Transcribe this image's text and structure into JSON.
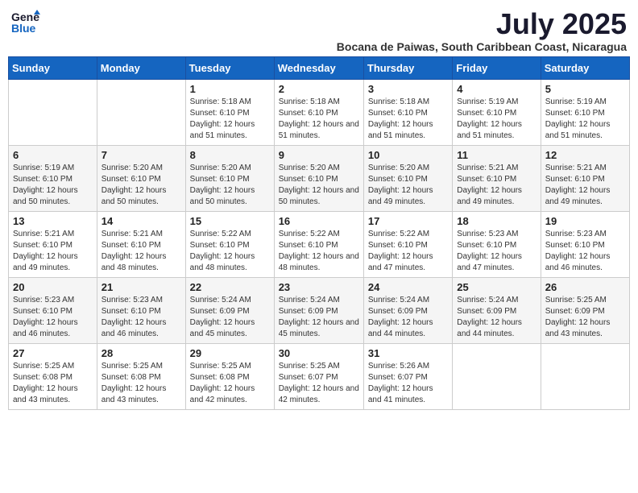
{
  "header": {
    "logo_line1": "General",
    "logo_line2": "Blue",
    "month_year": "July 2025",
    "location": "Bocana de Paiwas, South Caribbean Coast, Nicaragua"
  },
  "weekdays": [
    "Sunday",
    "Monday",
    "Tuesday",
    "Wednesday",
    "Thursday",
    "Friday",
    "Saturday"
  ],
  "weeks": [
    [
      {
        "day": "",
        "sunrise": "",
        "sunset": "",
        "daylight": ""
      },
      {
        "day": "",
        "sunrise": "",
        "sunset": "",
        "daylight": ""
      },
      {
        "day": "1",
        "sunrise": "Sunrise: 5:18 AM",
        "sunset": "Sunset: 6:10 PM",
        "daylight": "Daylight: 12 hours and 51 minutes."
      },
      {
        "day": "2",
        "sunrise": "Sunrise: 5:18 AM",
        "sunset": "Sunset: 6:10 PM",
        "daylight": "Daylight: 12 hours and 51 minutes."
      },
      {
        "day": "3",
        "sunrise": "Sunrise: 5:18 AM",
        "sunset": "Sunset: 6:10 PM",
        "daylight": "Daylight: 12 hours and 51 minutes."
      },
      {
        "day": "4",
        "sunrise": "Sunrise: 5:19 AM",
        "sunset": "Sunset: 6:10 PM",
        "daylight": "Daylight: 12 hours and 51 minutes."
      },
      {
        "day": "5",
        "sunrise": "Sunrise: 5:19 AM",
        "sunset": "Sunset: 6:10 PM",
        "daylight": "Daylight: 12 hours and 51 minutes."
      }
    ],
    [
      {
        "day": "6",
        "sunrise": "Sunrise: 5:19 AM",
        "sunset": "Sunset: 6:10 PM",
        "daylight": "Daylight: 12 hours and 50 minutes."
      },
      {
        "day": "7",
        "sunrise": "Sunrise: 5:20 AM",
        "sunset": "Sunset: 6:10 PM",
        "daylight": "Daylight: 12 hours and 50 minutes."
      },
      {
        "day": "8",
        "sunrise": "Sunrise: 5:20 AM",
        "sunset": "Sunset: 6:10 PM",
        "daylight": "Daylight: 12 hours and 50 minutes."
      },
      {
        "day": "9",
        "sunrise": "Sunrise: 5:20 AM",
        "sunset": "Sunset: 6:10 PM",
        "daylight": "Daylight: 12 hours and 50 minutes."
      },
      {
        "day": "10",
        "sunrise": "Sunrise: 5:20 AM",
        "sunset": "Sunset: 6:10 PM",
        "daylight": "Daylight: 12 hours and 49 minutes."
      },
      {
        "day": "11",
        "sunrise": "Sunrise: 5:21 AM",
        "sunset": "Sunset: 6:10 PM",
        "daylight": "Daylight: 12 hours and 49 minutes."
      },
      {
        "day": "12",
        "sunrise": "Sunrise: 5:21 AM",
        "sunset": "Sunset: 6:10 PM",
        "daylight": "Daylight: 12 hours and 49 minutes."
      }
    ],
    [
      {
        "day": "13",
        "sunrise": "Sunrise: 5:21 AM",
        "sunset": "Sunset: 6:10 PM",
        "daylight": "Daylight: 12 hours and 49 minutes."
      },
      {
        "day": "14",
        "sunrise": "Sunrise: 5:21 AM",
        "sunset": "Sunset: 6:10 PM",
        "daylight": "Daylight: 12 hours and 48 minutes."
      },
      {
        "day": "15",
        "sunrise": "Sunrise: 5:22 AM",
        "sunset": "Sunset: 6:10 PM",
        "daylight": "Daylight: 12 hours and 48 minutes."
      },
      {
        "day": "16",
        "sunrise": "Sunrise: 5:22 AM",
        "sunset": "Sunset: 6:10 PM",
        "daylight": "Daylight: 12 hours and 48 minutes."
      },
      {
        "day": "17",
        "sunrise": "Sunrise: 5:22 AM",
        "sunset": "Sunset: 6:10 PM",
        "daylight": "Daylight: 12 hours and 47 minutes."
      },
      {
        "day": "18",
        "sunrise": "Sunrise: 5:23 AM",
        "sunset": "Sunset: 6:10 PM",
        "daylight": "Daylight: 12 hours and 47 minutes."
      },
      {
        "day": "19",
        "sunrise": "Sunrise: 5:23 AM",
        "sunset": "Sunset: 6:10 PM",
        "daylight": "Daylight: 12 hours and 46 minutes."
      }
    ],
    [
      {
        "day": "20",
        "sunrise": "Sunrise: 5:23 AM",
        "sunset": "Sunset: 6:10 PM",
        "daylight": "Daylight: 12 hours and 46 minutes."
      },
      {
        "day": "21",
        "sunrise": "Sunrise: 5:23 AM",
        "sunset": "Sunset: 6:10 PM",
        "daylight": "Daylight: 12 hours and 46 minutes."
      },
      {
        "day": "22",
        "sunrise": "Sunrise: 5:24 AM",
        "sunset": "Sunset: 6:09 PM",
        "daylight": "Daylight: 12 hours and 45 minutes."
      },
      {
        "day": "23",
        "sunrise": "Sunrise: 5:24 AM",
        "sunset": "Sunset: 6:09 PM",
        "daylight": "Daylight: 12 hours and 45 minutes."
      },
      {
        "day": "24",
        "sunrise": "Sunrise: 5:24 AM",
        "sunset": "Sunset: 6:09 PM",
        "daylight": "Daylight: 12 hours and 44 minutes."
      },
      {
        "day": "25",
        "sunrise": "Sunrise: 5:24 AM",
        "sunset": "Sunset: 6:09 PM",
        "daylight": "Daylight: 12 hours and 44 minutes."
      },
      {
        "day": "26",
        "sunrise": "Sunrise: 5:25 AM",
        "sunset": "Sunset: 6:09 PM",
        "daylight": "Daylight: 12 hours and 43 minutes."
      }
    ],
    [
      {
        "day": "27",
        "sunrise": "Sunrise: 5:25 AM",
        "sunset": "Sunset: 6:08 PM",
        "daylight": "Daylight: 12 hours and 43 minutes."
      },
      {
        "day": "28",
        "sunrise": "Sunrise: 5:25 AM",
        "sunset": "Sunset: 6:08 PM",
        "daylight": "Daylight: 12 hours and 43 minutes."
      },
      {
        "day": "29",
        "sunrise": "Sunrise: 5:25 AM",
        "sunset": "Sunset: 6:08 PM",
        "daylight": "Daylight: 12 hours and 42 minutes."
      },
      {
        "day": "30",
        "sunrise": "Sunrise: 5:25 AM",
        "sunset": "Sunset: 6:07 PM",
        "daylight": "Daylight: 12 hours and 42 minutes."
      },
      {
        "day": "31",
        "sunrise": "Sunrise: 5:26 AM",
        "sunset": "Sunset: 6:07 PM",
        "daylight": "Daylight: 12 hours and 41 minutes."
      },
      {
        "day": "",
        "sunrise": "",
        "sunset": "",
        "daylight": ""
      },
      {
        "day": "",
        "sunrise": "",
        "sunset": "",
        "daylight": ""
      }
    ]
  ]
}
